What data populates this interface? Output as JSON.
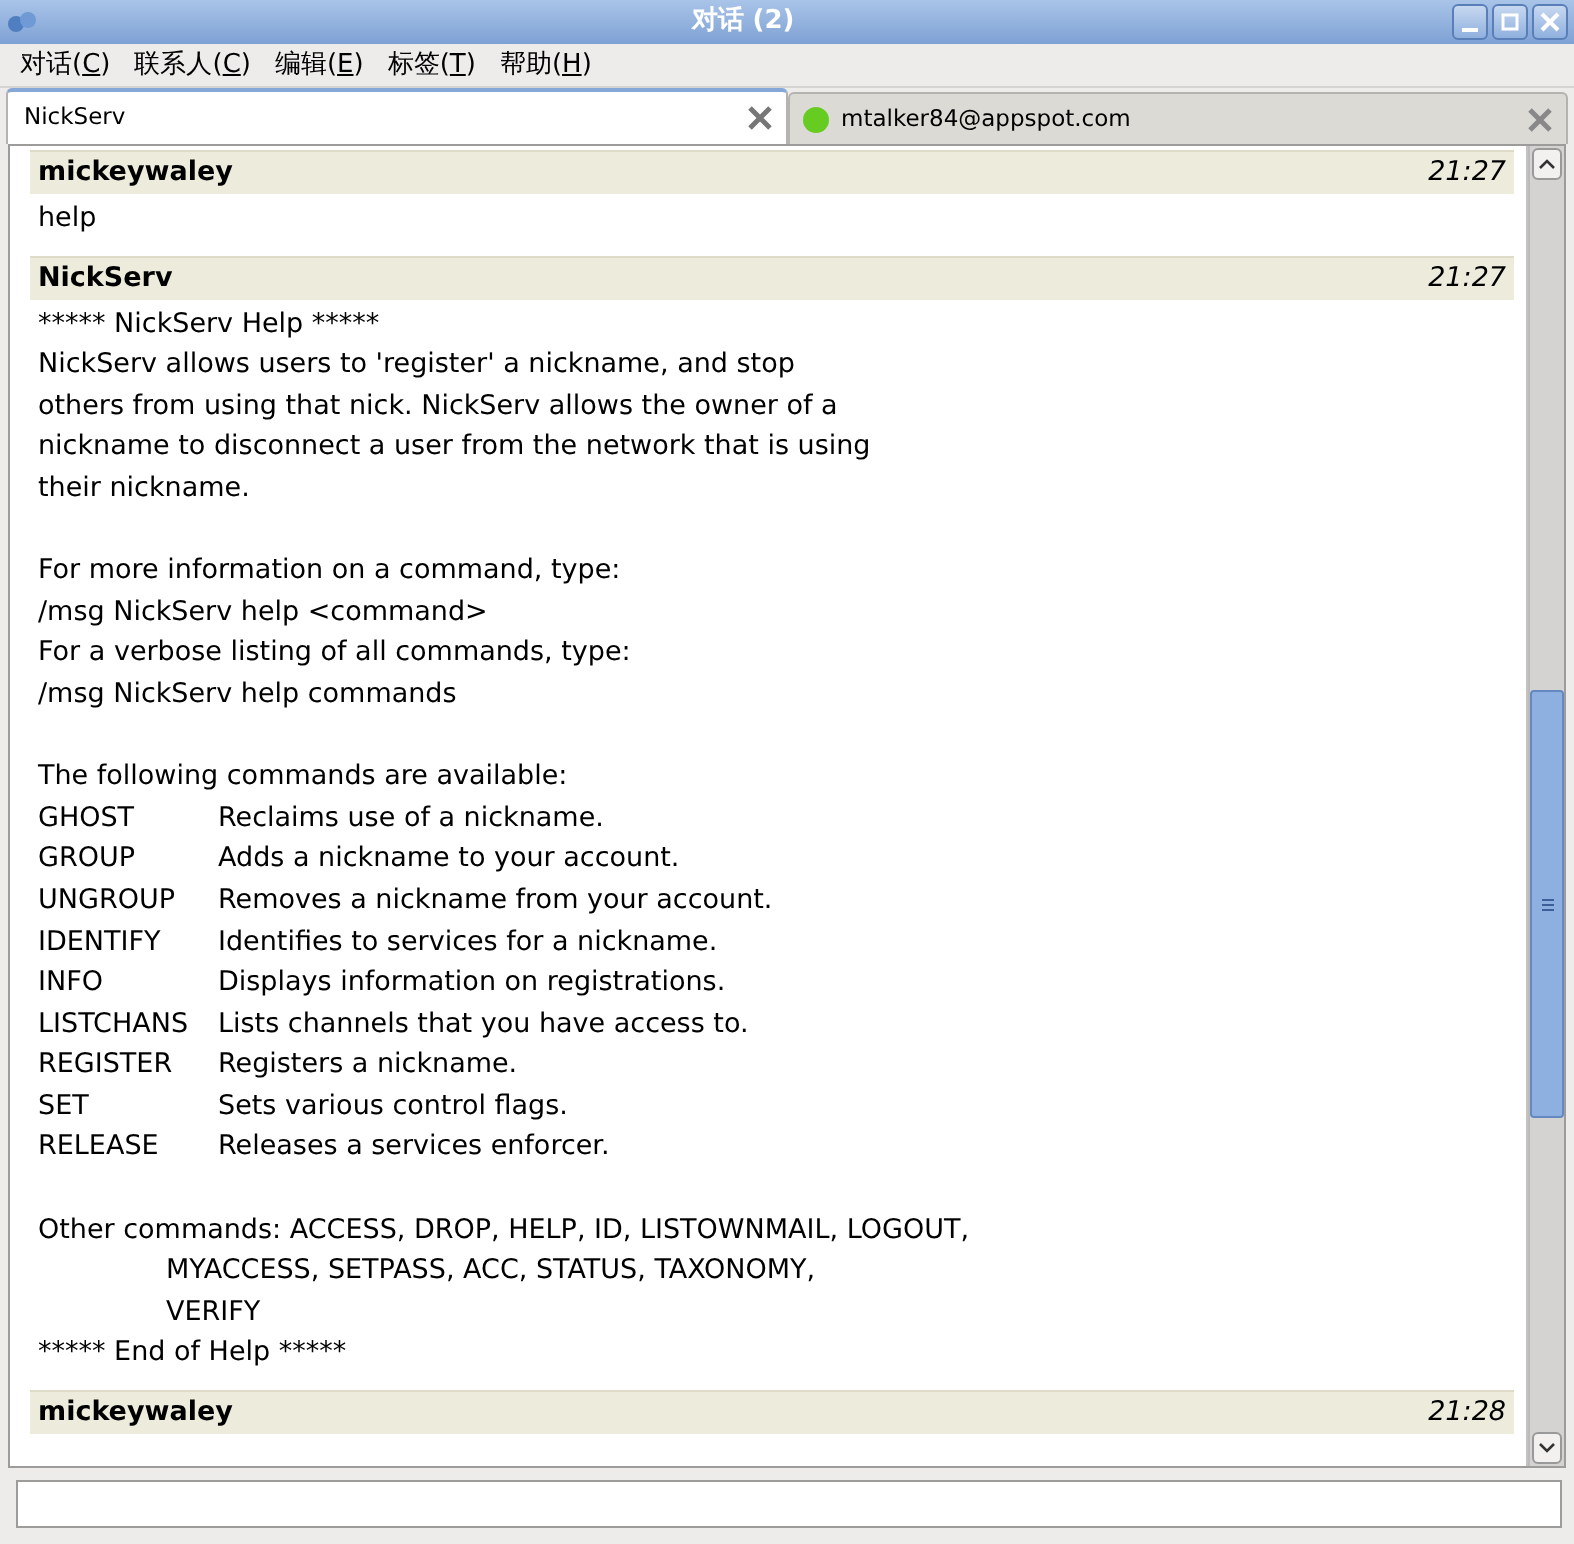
{
  "window": {
    "title": "对话 (2)"
  },
  "menu": [
    {
      "before": "对话(",
      "mnemonic": "C",
      "after": ")"
    },
    {
      "before": "联系人(",
      "mnemonic": "C",
      "after": ")"
    },
    {
      "before": "编辑(",
      "mnemonic": "E",
      "after": ")"
    },
    {
      "before": "标签(",
      "mnemonic": "T",
      "after": ")"
    },
    {
      "before": "帮助(",
      "mnemonic": "H",
      "after": ")"
    }
  ],
  "tabs": [
    {
      "label": "NickServ",
      "selected": true
    },
    {
      "label": "mtalker84@appspot.com",
      "selected": false,
      "color": "#66cc22"
    }
  ],
  "messages": [
    {
      "sender": "mickeywaley",
      "time": "21:27",
      "lines": [
        {
          "kind": "text",
          "text": "help"
        }
      ]
    },
    {
      "sender": "NickServ",
      "time": "21:27",
      "lines": [
        {
          "kind": "text",
          "text": "***** NickServ Help *****"
        },
        {
          "kind": "text",
          "text": "NickServ allows users to 'register' a nickname, and stop"
        },
        {
          "kind": "text",
          "text": "others from using that nick. NickServ allows the owner of a"
        },
        {
          "kind": "text",
          "text": "nickname to disconnect a user from the network that is using"
        },
        {
          "kind": "text",
          "text": "their nickname."
        },
        {
          "kind": "blank"
        },
        {
          "kind": "text",
          "text": "For more information on a command, type:"
        },
        {
          "kind": "text",
          "text": "/msg NickServ help <command>"
        },
        {
          "kind": "text",
          "text": "For a verbose listing of all commands, type:"
        },
        {
          "kind": "text",
          "text": "/msg NickServ help commands"
        },
        {
          "kind": "blank"
        },
        {
          "kind": "text",
          "text": "The following commands are available:"
        },
        {
          "kind": "command",
          "name": "GHOST",
          "description": "Reclaims use of a nickname."
        },
        {
          "kind": "command",
          "name": "GROUP",
          "description": "Adds a nickname to your account."
        },
        {
          "kind": "command",
          "name": "UNGROUP",
          "description": "Removes a nickname from your account."
        },
        {
          "kind": "command",
          "name": "IDENTIFY",
          "description": "Identifies to services for a nickname."
        },
        {
          "kind": "command",
          "name": "INFO",
          "description": "Displays information on registrations."
        },
        {
          "kind": "command",
          "name": "LISTCHANS",
          "description": "Lists channels that you have access to."
        },
        {
          "kind": "command",
          "name": "REGISTER",
          "description": "Registers a nickname."
        },
        {
          "kind": "command",
          "name": "SET",
          "description": "Sets various control flags."
        },
        {
          "kind": "command",
          "name": "RELEASE",
          "description": "Releases a services enforcer."
        },
        {
          "kind": "blank"
        },
        {
          "kind": "text",
          "text": "Other commands: ACCESS, DROP, HELP, ID, LISTOWNMAIL, LOGOUT,"
        },
        {
          "kind": "indented",
          "text": "MYACCESS, SETPASS, ACC, STATUS, TAXONOMY,"
        },
        {
          "kind": "indented",
          "text": "VERIFY"
        },
        {
          "kind": "text",
          "text": "***** End of Help *****"
        }
      ]
    },
    {
      "sender": "mickeywaley",
      "time": "21:28"
    }
  ]
}
